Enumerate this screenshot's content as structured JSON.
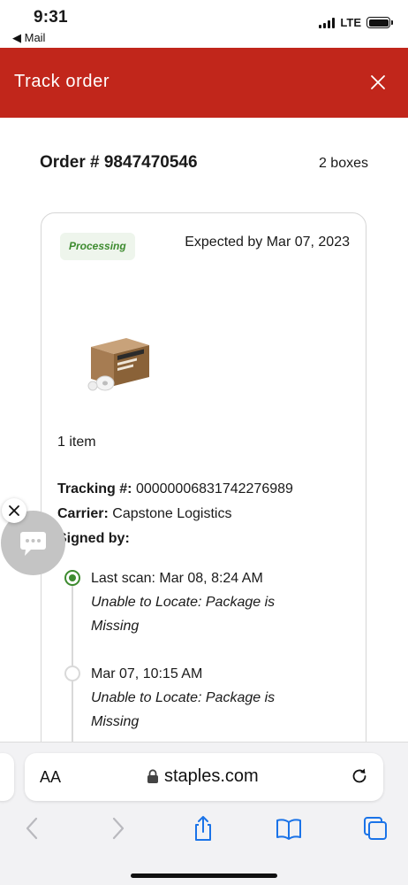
{
  "status_bar": {
    "time": "9:31",
    "back_app": "◀ Mail",
    "network": "LTE"
  },
  "header": {
    "title": "Track order",
    "background_color": "#c1261b"
  },
  "order": {
    "number_label": "Order # 9847470546",
    "boxes": "2 boxes"
  },
  "shipment": {
    "status": "Processing",
    "status_color": "#3d8b2f",
    "expected": "Expected by Mar 07, 2023",
    "item_count": "1 item",
    "tracking_label": "Tracking #:",
    "tracking_value": "00000006831742276989",
    "carrier_label": "Carrier:",
    "carrier_value": "Capstone Logistics",
    "signed_label": "Signed by:",
    "signed_value": ""
  },
  "timeline": [
    {
      "title": "Last scan: Mar 08, 8:24 AM",
      "desc_line1": "Unable to Locate: Package is",
      "desc_line2": "Missing",
      "state": "active"
    },
    {
      "title": "Mar 07, 10:15 AM",
      "desc_line1": "Unable to Locate: Package is",
      "desc_line2": "Missing",
      "state": "idle"
    }
  ],
  "browser": {
    "text_size_label": "AA",
    "url": "staples.com"
  }
}
